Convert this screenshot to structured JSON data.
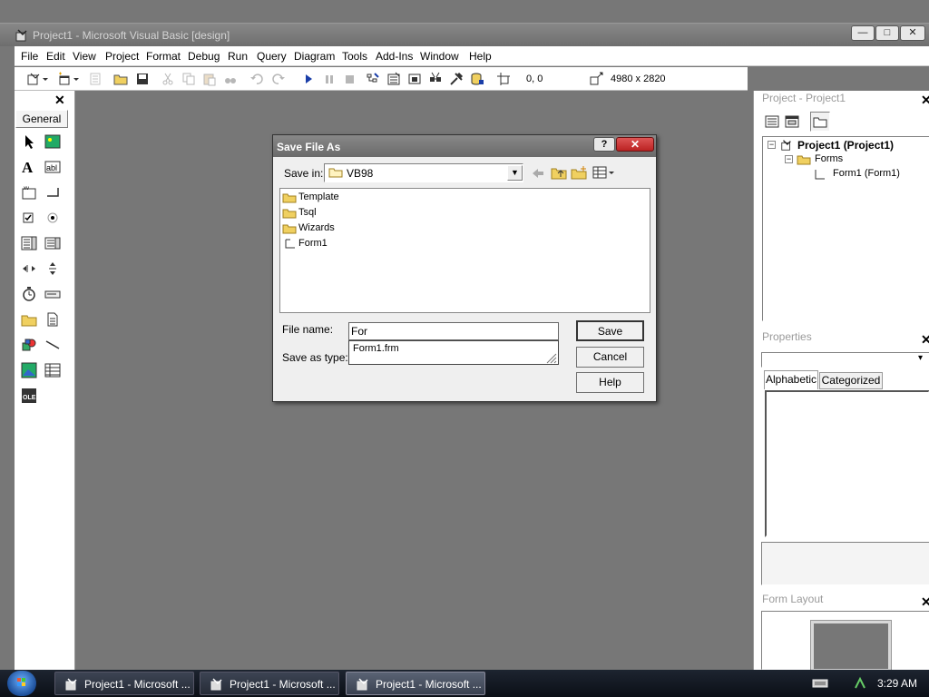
{
  "window": {
    "title": "Project1 - Microsoft Visual Basic [design]",
    "icon": "vb-app-icon"
  },
  "menubar": {
    "items": [
      "File",
      "Edit",
      "View",
      "Project",
      "Format",
      "Debug",
      "Run",
      "Query",
      "Diagram",
      "Tools",
      "Add-Ins",
      "Window",
      "Help"
    ]
  },
  "toolbar": {
    "position": "0, 0",
    "size": "4980 x 2820"
  },
  "toolbox": {
    "title": "General",
    "close": "✕"
  },
  "project_pane": {
    "title": "Project - Project1",
    "tree": {
      "root": "Project1 (Project1)",
      "folder": "Forms",
      "item": "Form1 (Form1)"
    }
  },
  "properties_pane": {
    "title": "Properties",
    "tabs": [
      "Alphabetic",
      "Categorized"
    ]
  },
  "form_layout_pane": {
    "title": "Form Layout"
  },
  "dialog": {
    "title": "Save File As",
    "help_btn": "?",
    "save_in_label": "Save in:",
    "save_in_value": "VB98",
    "files": [
      "Template",
      "Tsql",
      "Wizards",
      "Form1"
    ],
    "file_name_label": "File name:",
    "file_name_value": "For",
    "save_as_type_label": "Save as type:",
    "autocomplete": "Form1.frm",
    "buttons": {
      "save": "Save",
      "cancel": "Cancel",
      "help": "Help"
    }
  },
  "taskbar": {
    "tasks": [
      "Project1 - Microsoft ...",
      "Project1 - Microsoft ...",
      "Project1 - Microsoft ..."
    ],
    "clock": "3:29 AM"
  }
}
